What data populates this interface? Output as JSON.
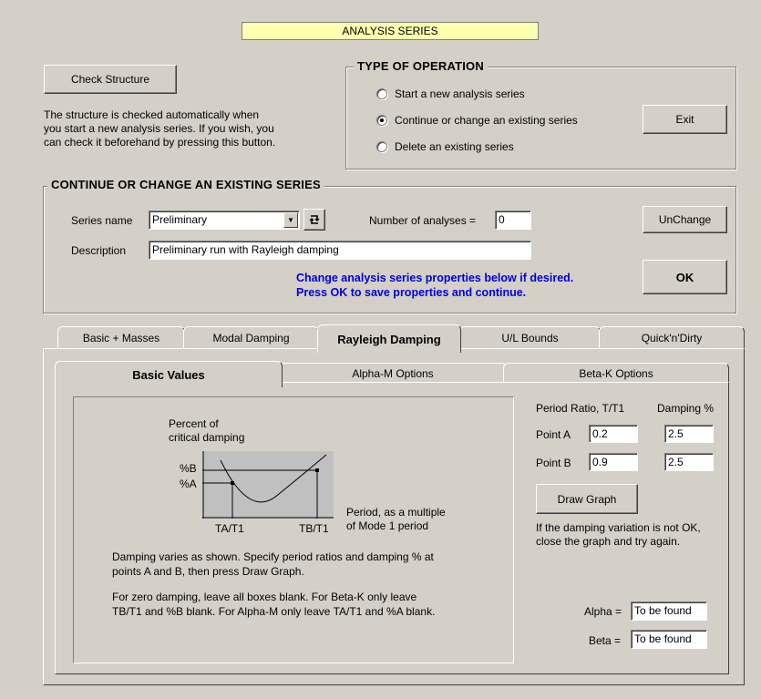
{
  "title": "ANALYSIS SERIES",
  "check_structure": {
    "button": "Check Structure",
    "note_lines": [
      "The structure is checked automatically when",
      "you start a new analysis series. If you wish, you",
      "can check it beforehand by pressing this button."
    ]
  },
  "type_of_operation": {
    "title": "TYPE OF OPERATION",
    "options": [
      "Start a new analysis series",
      "Continue or change an existing series",
      "Delete an existing series"
    ],
    "selected_index": 1,
    "exit_button": "Exit"
  },
  "continue_section": {
    "title": "CONTINUE OR CHANGE AN EXISTING SERIES",
    "series_name_label": "Series name",
    "series_name_value": "Preliminary",
    "num_analyses_label": "Number of analyses =",
    "num_analyses_value": "0",
    "unchange_button": "UnChange",
    "description_label": "Description",
    "description_value": "Preliminary run with Rayleigh damping",
    "hint_lines": [
      "Change analysis series properties below if desired.",
      "Press OK to save properties and continue."
    ],
    "ok_button": "OK"
  },
  "tabs": [
    "Basic + Masses",
    "Modal  Damping",
    "Rayleigh Damping",
    "U/L Bounds",
    "Quick'n'Dirty"
  ],
  "active_tab": 2,
  "subtabs": [
    "Basic Values",
    "Alpha-M Options",
    "Beta-K Options"
  ],
  "active_subtab": 0,
  "diagram": {
    "y_title_lines": [
      "Percent of",
      "critical damping"
    ],
    "label_b": "%B",
    "label_a": "%A",
    "x_label_a": "TA/T1",
    "x_label_b": "TB/T1",
    "x_title_lines": [
      "Period, as a multiple",
      "of Mode 1 period"
    ]
  },
  "instructions": {
    "para1_lines": [
      "Damping varies as shown. Specify period ratios and damping % at",
      "points A and B, then press Draw Graph."
    ],
    "para2_lines": [
      "For zero damping, leave all boxes blank. For Beta-K only leave",
      "TB/T1 and %B blank. For Alpha-M only leave TA/T1 and %A blank."
    ]
  },
  "points": {
    "period_header": "Period Ratio, T/T1",
    "damping_header": "Damping %",
    "point_a_label": "Point A",
    "point_a_period": "0.2",
    "point_a_damping": "2.5",
    "point_b_label": "Point B",
    "point_b_period": "0.9",
    "point_b_damping": "2.5",
    "draw_graph_button": "Draw Graph",
    "note_lines": [
      "If the damping variation is not OK,",
      "close the graph and try again."
    ]
  },
  "coefficients": {
    "alpha_label": "Alpha =",
    "alpha_value": "To be found",
    "beta_label": "Beta =",
    "beta_value": "To be found"
  },
  "colors": {
    "title_bar": "#ffffb0",
    "hint_text": "#0000e0",
    "graph_bg": "#c0c0c0"
  }
}
